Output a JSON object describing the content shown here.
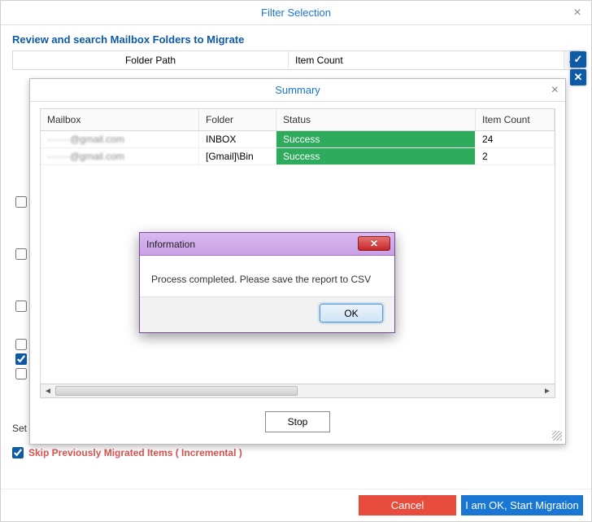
{
  "filter": {
    "title": "Filter Selection",
    "subtitle": "Review and search Mailbox Folders to Migrate",
    "columns": {
      "folder": "Folder Path",
      "count": "Item Count"
    },
    "set_label": "Set",
    "skip_label": "Skip Previously Migrated Items ( Incremental )",
    "cancel": "Cancel",
    "start": "I am OK, Start Migration",
    "side_check": "✓",
    "side_x": "✕",
    "scroll_up": "▲"
  },
  "summary": {
    "title": "Summary",
    "columns": {
      "mailbox": "Mailbox",
      "folder": "Folder",
      "status": "Status",
      "count": "Item Count"
    },
    "rows": [
      {
        "mailbox": "·······@gmail.com",
        "folder": "INBOX",
        "status": "Success",
        "count": "24"
      },
      {
        "mailbox": "·······@gmail.com",
        "folder": "[Gmail]\\Bin",
        "status": "Success",
        "count": "2"
      }
    ],
    "stop": "Stop",
    "scroll_left": "◄",
    "scroll_right": "►"
  },
  "info": {
    "title": "Information",
    "message": "Process completed. Please save the report to CSV",
    "ok": "OK",
    "close_glyph": "✕"
  }
}
